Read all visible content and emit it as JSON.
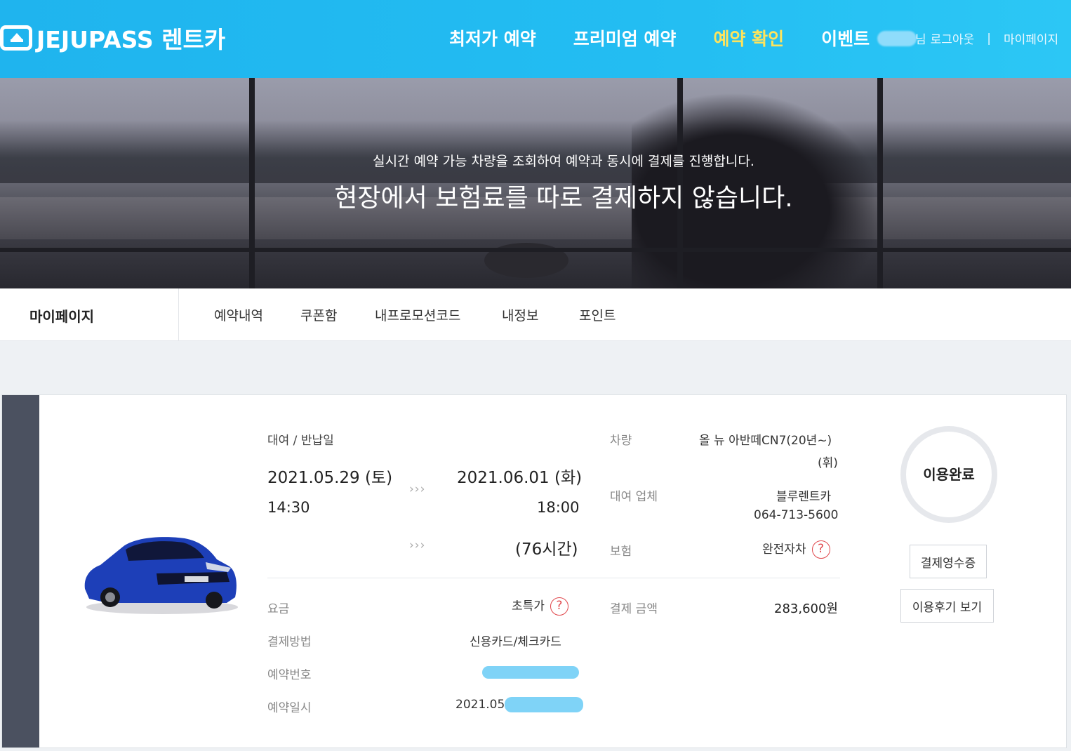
{
  "header": {
    "logo_text": "JEJUPASS 렌트카",
    "nav": [
      "최저가 예약",
      "프리미엄 예약",
      "예약 확인",
      "이벤트"
    ],
    "user_suffix": "님",
    "logout": "로그아웃",
    "separator": "|",
    "mypage": "마이페이지"
  },
  "hero": {
    "subtitle": "실시간 예약 가능 차량을 조회하여 예약과 동시에 결제를 진행합니다.",
    "title": "현장에서 보험료를 따로 결제하지 않습니다."
  },
  "mypage": {
    "title": "마이페이지",
    "tabs": [
      "예약내역",
      "쿠폰함",
      "내프로모션코드",
      "내정보",
      "포인트"
    ]
  },
  "reservation": {
    "period_label": "대여 / 반납일",
    "pickup_date": "2021.05.29 (토)",
    "pickup_time": "14:30",
    "return_date": "2021.06.01 (화)",
    "return_time": "18:00",
    "duration": "(76시간)",
    "arrows": "›››",
    "vehicle_label": "차량",
    "vehicle_line1": "올 뉴 아반떼CN7(20년~)",
    "vehicle_line2": "(휘)",
    "company_label": "대여 업체",
    "company_name": "블루렌트카",
    "company_phone": "064-713-5600",
    "insurance_label": "보험",
    "insurance_value": "완전자차",
    "fare_label": "요금",
    "fare_value": "초특가",
    "payment_amount_label": "결제 금액",
    "payment_amount": "283,600원",
    "payment_method_label": "결제방법",
    "payment_method": "신용카드/체크카드",
    "reservation_no_label": "예약번호",
    "reservation_datetime_label": "예약일시",
    "reservation_datetime": "2021.05.",
    "help_icon": "?",
    "status": "이용완료",
    "receipt_button": "결제영수증",
    "review_button": "이용후기 보기"
  },
  "colors": {
    "header": "#23bdf2",
    "nav_active": "#ffe45c",
    "sidebar": "#4b5160",
    "help_red": "#e0474c",
    "redaction": "#7fd3f7"
  }
}
